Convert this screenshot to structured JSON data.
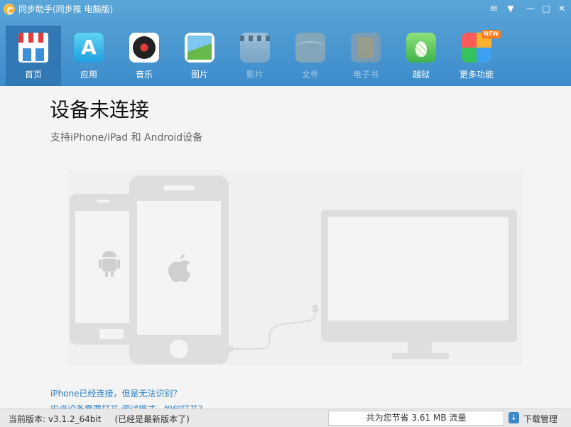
{
  "window": {
    "title": "同步助手(同步推 电脑版)"
  },
  "toolbar": {
    "items": [
      {
        "label": "首页",
        "icon": "home-store-icon",
        "active": true
      },
      {
        "label": "应用",
        "icon": "app-store-icon"
      },
      {
        "label": "音乐",
        "icon": "music-disc-icon"
      },
      {
        "label": "图片",
        "icon": "photo-icon"
      },
      {
        "label": "影片",
        "icon": "video-clapper-icon",
        "disabled": true
      },
      {
        "label": "文件",
        "icon": "file-folder-icon",
        "disabled": true
      },
      {
        "label": "电子书",
        "icon": "ebook-icon",
        "disabled": true
      },
      {
        "label": "越狱",
        "icon": "jailbreak-pineapple-icon"
      },
      {
        "label": "更多功能",
        "icon": "more-features-icon",
        "badge": "NEW"
      }
    ]
  },
  "main": {
    "heading": "设备未连接",
    "subheading": "支持iPhone/iPad 和 Android设备",
    "links": [
      "iPhone已经连接，但是无法识别？",
      "安卓设备需要打开 调试模式，如何打开？"
    ]
  },
  "status": {
    "version": "当前版本: v3.1.2_64bit",
    "latest": "(已经是最新版本了)",
    "saved": "共为您节省  3.61 MB 流量",
    "download_manager": "下载管理"
  },
  "colors": {
    "titlebar": "#4a9bd4",
    "active_tab": "#3179b5",
    "link": "#2a7fc6"
  }
}
